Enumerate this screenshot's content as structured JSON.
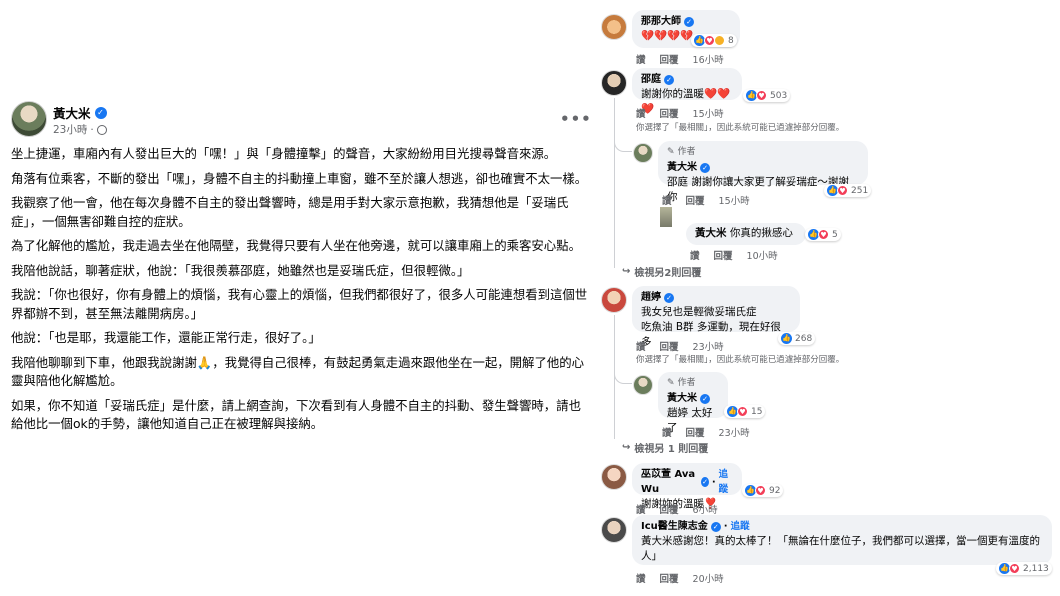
{
  "post": {
    "author": "黃大米",
    "time": "23小時",
    "time_sep": "·",
    "more": "•••",
    "paragraphs": [
      "坐上捷運，車廂內有人發出巨大的「嘿！」與「身體撞擊」的聲音，大家紛紛用目光搜尋聲音來源。",
      "角落有位乘客，不斷的發出「嘿」，身體不自主的抖動撞上車窗，雖不至於讓人想逃，卻也確實不太一樣。",
      "我觀察了他一會，他在每次身體不自主的發出聲響時，總是用手對大家示意抱歉，我猜想他是「妥瑞氏症」，一個無害卻難自控的症狀。",
      "為了化解他的尷尬，我走過去坐在他隔壁，我覺得只要有人坐在他旁邊，就可以讓車廂上的乘客安心點。",
      "我陪他說話，聊著症狀，他說：「我很羨慕邵庭，她雖然也是妥瑞氏症，但很輕微。」",
      "我說：「你也很好，你有身體上的煩惱，我有心靈上的煩惱，但我們都很好了，很多人可能連想看到這個世界都辦不到，甚至無法離開病房。」",
      "他說：「也是耶，我還能工作，還能正常行走，很好了。」",
      "我陪他聊聊到下車，他跟我說謝謝🙏，我覺得自己很棒，有鼓起勇氣走過來跟他坐在一起，開解了他的心靈與陪他化解尷尬。",
      "如果，你不知道「妥瑞氏症」是什麼，請上網查詢，下次看到有人身體不自主的抖動、發生聲響時，請也給他比一個ok的手勢，讓他知道自己正在被理解與接納。"
    ]
  },
  "actions": {
    "like": "讚",
    "reply": "回覆"
  },
  "comments": [
    {
      "name": "那那大師",
      "text": "💔💔💔💔",
      "reactions": "8",
      "time": "16小時"
    },
    {
      "name": "邵庭",
      "text": "謝謝你的溫暖❤️❤️❤️",
      "reactions": "503",
      "time": "15小時",
      "note": "你選擇了「最相關」，因此系統可能已過濾掉部分回覆。",
      "replies": [
        {
          "author_tag": "作者",
          "name": "黃大米",
          "text": "邵庭 謝謝你讓大家更了解妥瑞症～謝謝你",
          "reactions": "251",
          "time": "15小時"
        },
        {
          "name": "黃大米",
          "text": "你真的揪感心",
          "reactions": "5",
          "time": "10小時"
        }
      ],
      "view_more": "檢視另2則回覆"
    },
    {
      "name": "趙婷",
      "text": "我女兒也是輕微妥瑞氏症\n吃魚油 B群 多運動，現在好很多",
      "reactions": "268",
      "time": "23小時",
      "note": "你選擇了「最相關」，因此系統可能已過濾掉部分回覆。",
      "replies": [
        {
          "author_tag": "作者",
          "name": "黃大米",
          "text": "趙婷 太好了",
          "reactions": "15",
          "time": "23小時"
        }
      ],
      "view_more": "檢視另 1 則回覆"
    },
    {
      "name": "巫苡萱 Ava Wu",
      "follow": "追蹤",
      "text": "謝謝妳的溫暖❣️",
      "reactions": "92",
      "time": "6小時"
    },
    {
      "name": "Icu醫生陳志金",
      "follow": "追蹤",
      "text": "黃大米感謝您！真的太棒了！「無論在什麼位子，我們都可以選擇，當一個更有溫度的人」",
      "reactions": "2,113",
      "time": "20小時"
    }
  ]
}
